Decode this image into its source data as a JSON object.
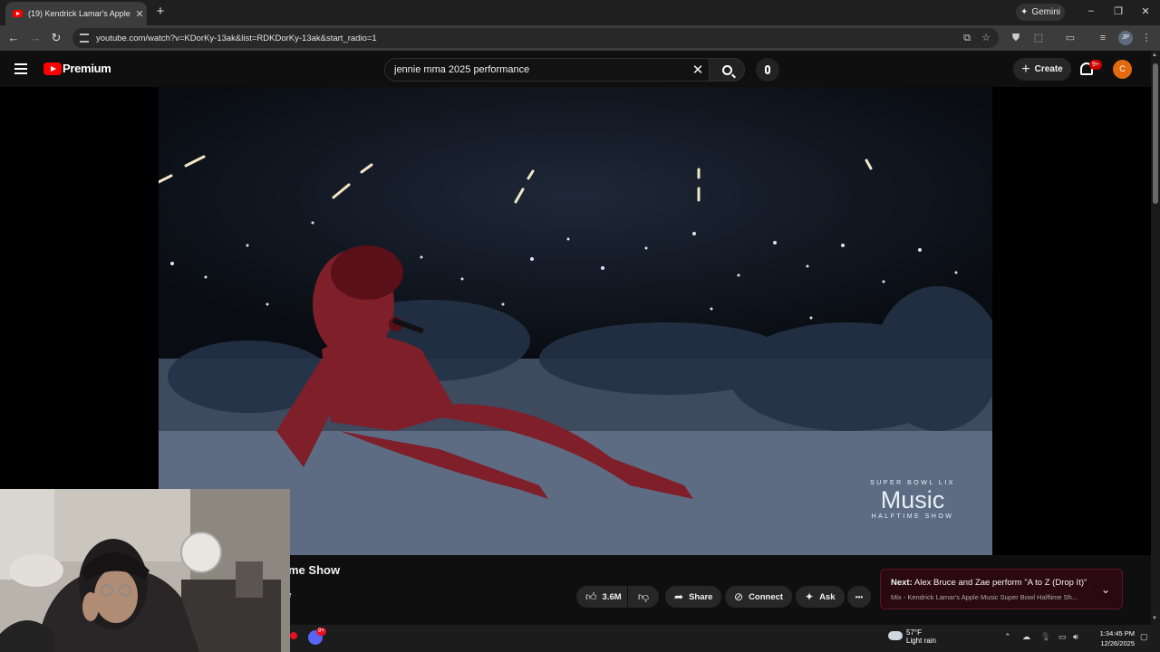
{
  "browser": {
    "tab_title": "(19) Kendrick Lamar's Apple M...",
    "tab_close": "✕",
    "new_tab": "+",
    "gemini_label": "Gemini",
    "url": "youtube.com/watch?v=KDorKy-13ak&list=RDKDorKy-13ak&start_radio=1",
    "profile_initials": "JP",
    "window_controls": [
      "–",
      "❐",
      "✕"
    ]
  },
  "youtube": {
    "logo_text": "Premium",
    "search_value": "jennie mma 2025 performance",
    "create_label": "Create",
    "notification_badge": "9+",
    "avatar_initial": "C"
  },
  "video": {
    "overlay_top": "SUPER BOWL LIX",
    "overlay_brand": "Music",
    "overlay_bottom": "HALFTIME SHOW",
    "title_visible": "me Show",
    "channel_fragment": "e"
  },
  "actions": {
    "like_count": "3.6M",
    "share_label": "Share",
    "connect_label": "Connect",
    "ask_label": "Ask",
    "more_label": "•••"
  },
  "next_card": {
    "prefix": "Next:",
    "title": "Alex Bruce and Zae perform \"A to Z (Drop It)\" ...",
    "subtitle": "Mix - Kendrick Lamar's Apple Music Super Bowl Halftime Sh..."
  },
  "taskbar": {
    "discord_badge": "9+",
    "temperature": "57°F",
    "weather_desc": "Light rain",
    "time": "1:34:45 PM",
    "date": "12/26/2025"
  },
  "colors": {
    "youtube_red": "#ff0000",
    "avatar": "#e36b0e",
    "background": "#0f0f0f"
  }
}
